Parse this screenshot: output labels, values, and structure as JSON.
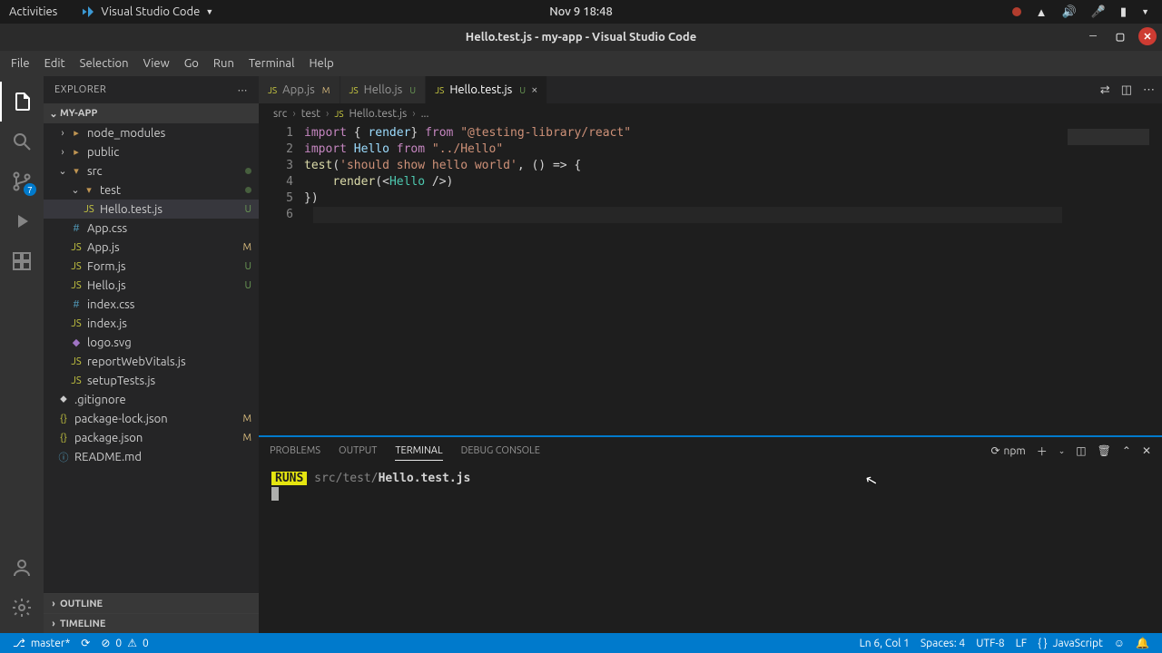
{
  "gnome": {
    "activities": "Activities",
    "app_name": "Visual Studio Code",
    "clock": "Nov 9  18:48"
  },
  "window": {
    "title": "Hello.test.js - my-app - Visual Studio Code"
  },
  "menubar": [
    "File",
    "Edit",
    "Selection",
    "View",
    "Go",
    "Run",
    "Terminal",
    "Help"
  ],
  "activity_badge": "7",
  "sidebar": {
    "title": "EXPLORER",
    "root": "MY-APP",
    "outline": "OUTLINE",
    "timeline": "TIMELINE"
  },
  "tree": {
    "node_modules": "node_modules",
    "public": "public",
    "src": "src",
    "test": "test",
    "hello_test": "Hello.test.js",
    "app_css": "App.css",
    "app_js": "App.js",
    "form_js": "Form.js",
    "hello_js": "Hello.js",
    "index_css": "index.css",
    "index_js": "index.js",
    "logo_svg": "logo.svg",
    "report": "reportWebVitals.js",
    "setup": "setupTests.js",
    "gitignore": ".gitignore",
    "pkglock": "package-lock.json",
    "pkg": "package.json",
    "readme": "README.md"
  },
  "status": {
    "app_js": "M",
    "form_js": "U",
    "hello_js": "U",
    "hello_test": "U",
    "pkglock": "M",
    "pkg": "M"
  },
  "tabs": [
    {
      "label": "App.js",
      "status": "M"
    },
    {
      "label": "Hello.js",
      "status": "U"
    },
    {
      "label": "Hello.test.js",
      "status": "U"
    }
  ],
  "breadcrumb": {
    "src": "src",
    "test": "test",
    "file": "Hello.test.js",
    "more": "..."
  },
  "code": {
    "l1": {
      "import": "import",
      "brace_open": " { ",
      "render": "render",
      "brace_close": "} ",
      "from": "from",
      "str": " \"@testing-library/react\""
    },
    "l2": {
      "import": "import",
      "hello": " Hello ",
      "from": "from",
      "str": " \"../Hello\""
    },
    "l3": {
      "test": "test",
      "open": "(",
      "str": "'should show hello world'",
      "mid": ", () => {"
    },
    "l4": {
      "indent": "    ",
      "render": "render",
      "open": "(<",
      "hello": "Hello",
      "close": " />)"
    },
    "l5": "})",
    "l6": ""
  },
  "line_numbers": [
    "1",
    "2",
    "3",
    "4",
    "5",
    "6"
  ],
  "panel_tabs": {
    "problems": "PROBLEMS",
    "output": "OUTPUT",
    "terminal": "TERMINAL",
    "debug": "DEBUG CONSOLE"
  },
  "terminal": {
    "shell_label": "npm",
    "runs": "RUNS",
    "path_dim": " src/test/",
    "path_bold": "Hello.test.js"
  },
  "statusbar": {
    "branch": "master*",
    "errors": "0",
    "warnings": "0",
    "position": "Ln 6, Col 1",
    "spaces": "Spaces: 4",
    "encoding": "UTF-8",
    "eol": "LF",
    "lang": "JavaScript"
  }
}
